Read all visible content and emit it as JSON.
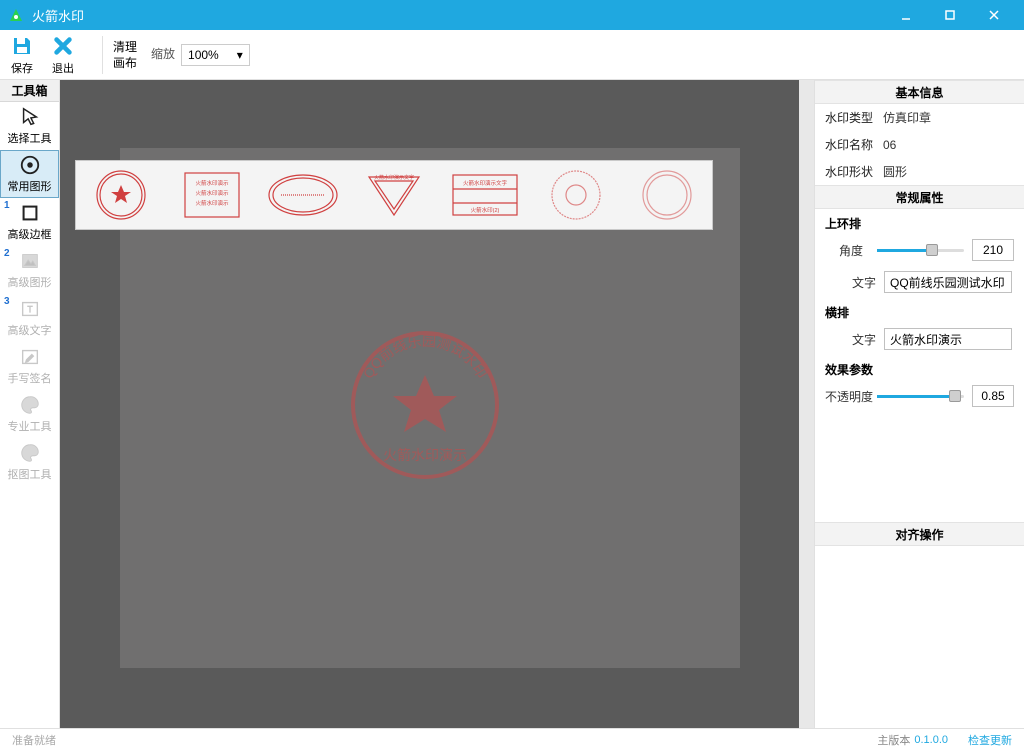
{
  "titlebar": {
    "title": "火箭水印"
  },
  "ribbon": {
    "save": "保存",
    "exit": "退出",
    "clear": "清理\n画布",
    "zoom_label": "缩放",
    "zoom_value": "100%"
  },
  "toolbox": {
    "header": "工具箱",
    "items": [
      {
        "label": "选择工具",
        "icon": "cursor"
      },
      {
        "label": "常用图形",
        "icon": "circle-dot",
        "selected": true
      },
      {
        "label": "高级边框",
        "icon": "square",
        "badge": "1"
      },
      {
        "label": "高级图形",
        "icon": "image",
        "badge": "2",
        "disabled": true
      },
      {
        "label": "高级文字",
        "icon": "text-box",
        "badge": "3",
        "disabled": true
      },
      {
        "label": "手写签名",
        "icon": "edit",
        "disabled": true
      },
      {
        "label": "专业工具",
        "icon": "palette",
        "disabled": true
      },
      {
        "label": "抠图工具",
        "icon": "palette",
        "disabled": true
      }
    ]
  },
  "canvas": {
    "stamp_arc_text": "QQ前线乐园测试水印",
    "stamp_bottom_text": "火箭水印演示"
  },
  "gallery": {
    "item2": {
      "l1": "火箭水印演示",
      "l2": "火箭水印演示",
      "l3": "火箭水印演示"
    },
    "item4": {
      "t": "火箭水印演示文字"
    },
    "item5": {
      "t": "火箭水印演示文字",
      "b": "火箭水印(2)"
    }
  },
  "panel": {
    "basic": {
      "header": "基本信息",
      "type_k": "水印类型",
      "type_v": "仿真印章",
      "name_k": "水印名称",
      "name_v": "06",
      "shape_k": "水印形状",
      "shape_v": "圆形"
    },
    "common": {
      "header": "常规属性",
      "upper": "上环排",
      "angle_k": "角度",
      "angle_v": "210",
      "text_k": "文字",
      "text_v": "QQ前线乐园测试水印",
      "horiz": "横排",
      "htext_k": "文字",
      "htext_v": "火箭水印演示"
    },
    "effect": {
      "header": "效果参数",
      "opacity_k": "不透明度",
      "opacity_v": "0.85"
    },
    "align": {
      "header": "对齐操作"
    }
  },
  "status": {
    "ready": "准备就绪",
    "ver_label": "主版本",
    "ver_value": "0.1.0.0",
    "update": "检查更新"
  }
}
